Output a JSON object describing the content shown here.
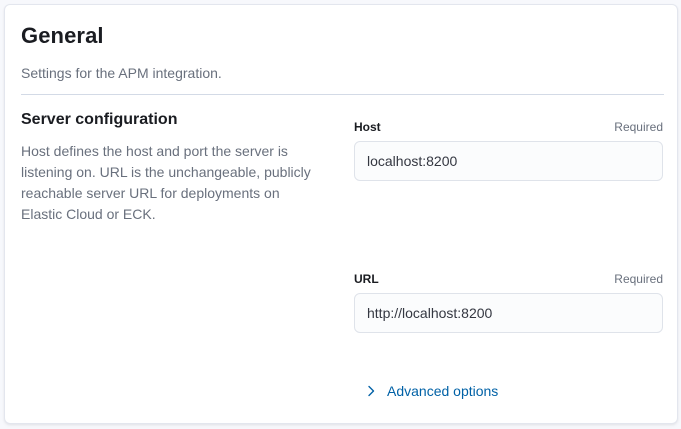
{
  "general": {
    "title": "General",
    "subtitle": "Settings for the APM integration."
  },
  "server_config": {
    "title": "Server configuration",
    "description": "Host defines the host and port the server is listening on. URL is the unchangeable, publicly reachable server URL for deployments on Elastic Cloud or ECK."
  },
  "fields": {
    "host": {
      "label": "Host",
      "hint": "Required",
      "value": "localhost:8200"
    },
    "url": {
      "label": "URL",
      "hint": "Required",
      "value": "http://localhost:8200"
    }
  },
  "advanced": {
    "label": "Advanced options",
    "icon": "chevron-right-icon"
  },
  "colors": {
    "link": "#0061a6",
    "heading": "#1a1c21",
    "muted": "#69707d"
  }
}
